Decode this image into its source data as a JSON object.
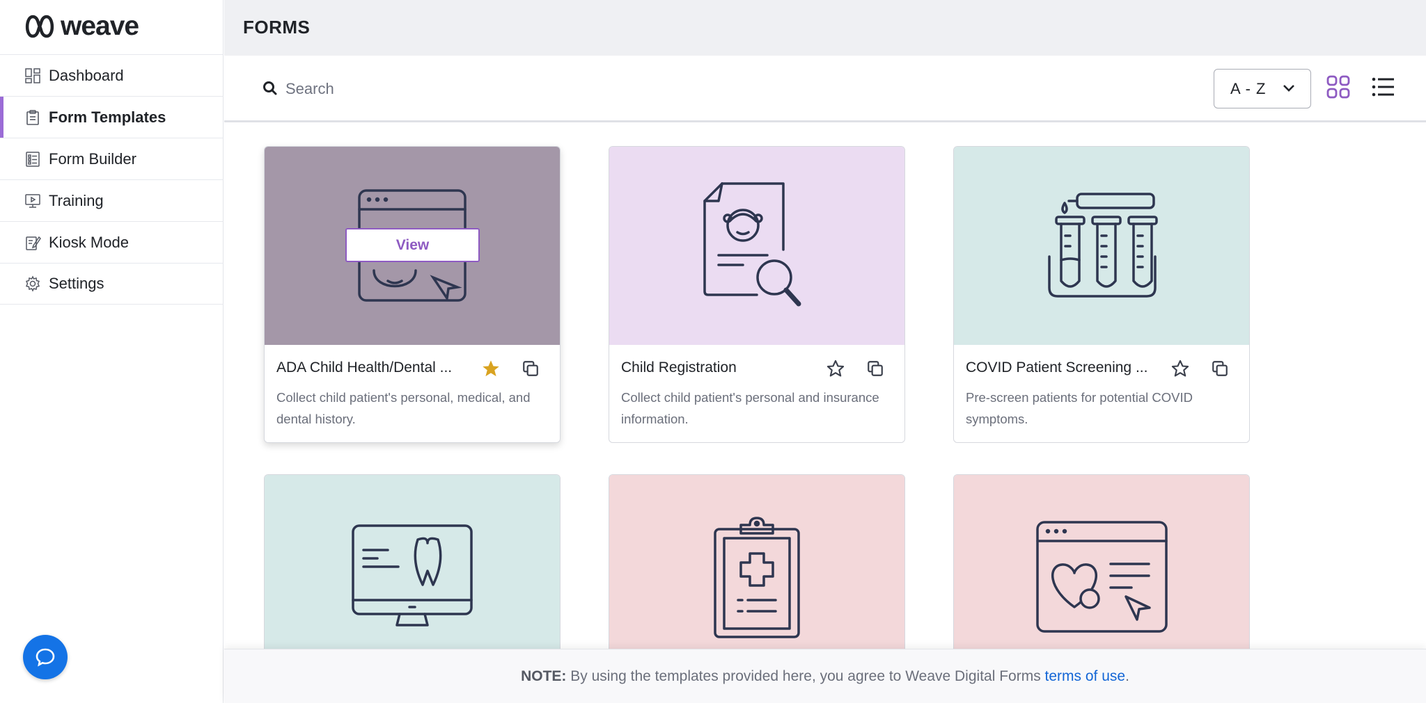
{
  "app": {
    "logo_text": "weave"
  },
  "sidebar": {
    "items": [
      {
        "label": "Dashboard",
        "icon": "dashboard-icon"
      },
      {
        "label": "Form Templates",
        "icon": "clipboard-icon",
        "active": true
      },
      {
        "label": "Form Builder",
        "icon": "form-builder-icon"
      },
      {
        "label": "Training",
        "icon": "presentation-icon"
      },
      {
        "label": "Kiosk Mode",
        "icon": "kiosk-icon"
      },
      {
        "label": "Settings",
        "icon": "gear-icon"
      }
    ],
    "chat_icon": "chat-bubble-icon"
  },
  "header": {
    "title": "FORMS"
  },
  "toolbar": {
    "search_placeholder": "Search",
    "search_value": "",
    "sort_value": "A - Z",
    "view_modes": [
      "grid-view-icon",
      "list-view-icon"
    ],
    "active_view": "grid"
  },
  "cards": [
    {
      "title": "ADA Child Health/Dental ...",
      "description": "Collect child patient's personal, medical, and dental history.",
      "starred": true,
      "bg": "#a497a8",
      "illustration": "child-browser-illustration",
      "hover_label": "View"
    },
    {
      "title": "Child Registration",
      "description": "Collect child patient's personal and insurance information.",
      "starred": false,
      "bg": "#ebdcf2",
      "illustration": "child-document-search-illustration"
    },
    {
      "title": "COVID Patient Screening ...",
      "description": "Pre-screen patients for potential COVID symptoms.",
      "starred": false,
      "bg": "#d6e9e8",
      "illustration": "test-tubes-illustration"
    },
    {
      "title": "",
      "description": "",
      "starred": false,
      "bg": "#d6e9e8",
      "illustration": "tooth-monitor-illustration"
    },
    {
      "title": "",
      "description": "",
      "starred": false,
      "bg": "#f3d8da",
      "illustration": "medical-clipboard-illustration"
    },
    {
      "title": "",
      "description": "",
      "starred": false,
      "bg": "#f3d8da",
      "illustration": "heart-browser-illustration"
    }
  ],
  "footer": {
    "note_label": "NOTE:",
    "note_text": " By using the templates provided here, you agree to Weave Digital Forms ",
    "link_text": "terms of use",
    "end": "."
  },
  "colors": {
    "accent": "#8e5bc2",
    "star_filled": "#d9a321",
    "link": "#1466d6",
    "chat": "#1473e6",
    "icon_stroke": "#3a4158"
  }
}
